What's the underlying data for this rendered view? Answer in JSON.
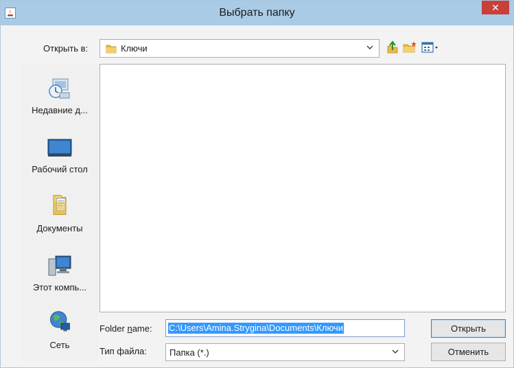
{
  "window": {
    "title": "Выбрать папку",
    "close_symbol": "✕"
  },
  "look_in": {
    "label": "Открыть в:",
    "value": "Ключи"
  },
  "toolbar": {
    "up": "up-folder",
    "new_folder": "new-folder",
    "view": "view-menu"
  },
  "places": [
    {
      "label": "Недавние д...",
      "icon": "recent-icon"
    },
    {
      "label": "Рабочий стол",
      "icon": "desktop-icon"
    },
    {
      "label": "Документы",
      "icon": "documents-icon"
    },
    {
      "label": "Этот компь...",
      "icon": "computer-icon"
    },
    {
      "label": "Сеть",
      "icon": "network-icon"
    }
  ],
  "folder_name": {
    "label_pre": "Folder ",
    "label_mn": "n",
    "label_post": "ame:",
    "value": "C:\\Users\\Amina.Strygina\\Documents\\Ключи"
  },
  "file_type": {
    "label": "Тип файла:",
    "value": "Папка (*.)"
  },
  "buttons": {
    "open": "Открыть",
    "cancel": "Отменить"
  },
  "colors": {
    "titlebar": "#a9cbe6",
    "close": "#c7413a",
    "selection": "#3399ff"
  }
}
